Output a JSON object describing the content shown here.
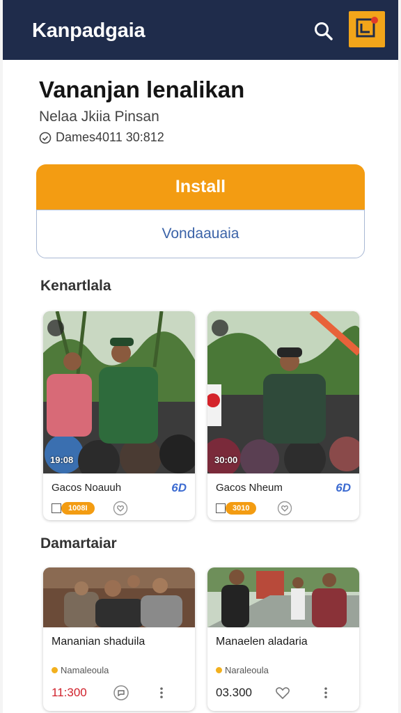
{
  "header": {
    "brand": "Kanpadgaia",
    "search_icon": "search-icon",
    "menu_icon": "menu-icon"
  },
  "hero": {
    "title": "Vananjan lenalikan",
    "subtitle": "Nelaa Jkiia Pinsan",
    "meta": "Dames4011  30:812"
  },
  "actions": {
    "install": "Install",
    "secondary": "Vondaauaia"
  },
  "section1": {
    "title": "Kenartlala",
    "cards": [
      {
        "title": "Gacos Noauuh",
        "duration": "19:08",
        "badge": "6D",
        "pill": "1008I"
      },
      {
        "title": "Gacos Nheum",
        "duration": "30:00",
        "badge": "6D",
        "pill": "3010"
      }
    ]
  },
  "section2": {
    "title": "Damartaiar",
    "cards": [
      {
        "title": "Mananian shaduila",
        "author": "Namaleoula",
        "price": "11:300"
      },
      {
        "title": "Manaelen aladaria",
        "author": "Naraleoula",
        "price": "03.300"
      }
    ]
  },
  "colors": {
    "header_bg": "#1f2c4b",
    "accent": "#f39c12",
    "link_blue": "#3b63a8",
    "price_red": "#d0212b"
  }
}
